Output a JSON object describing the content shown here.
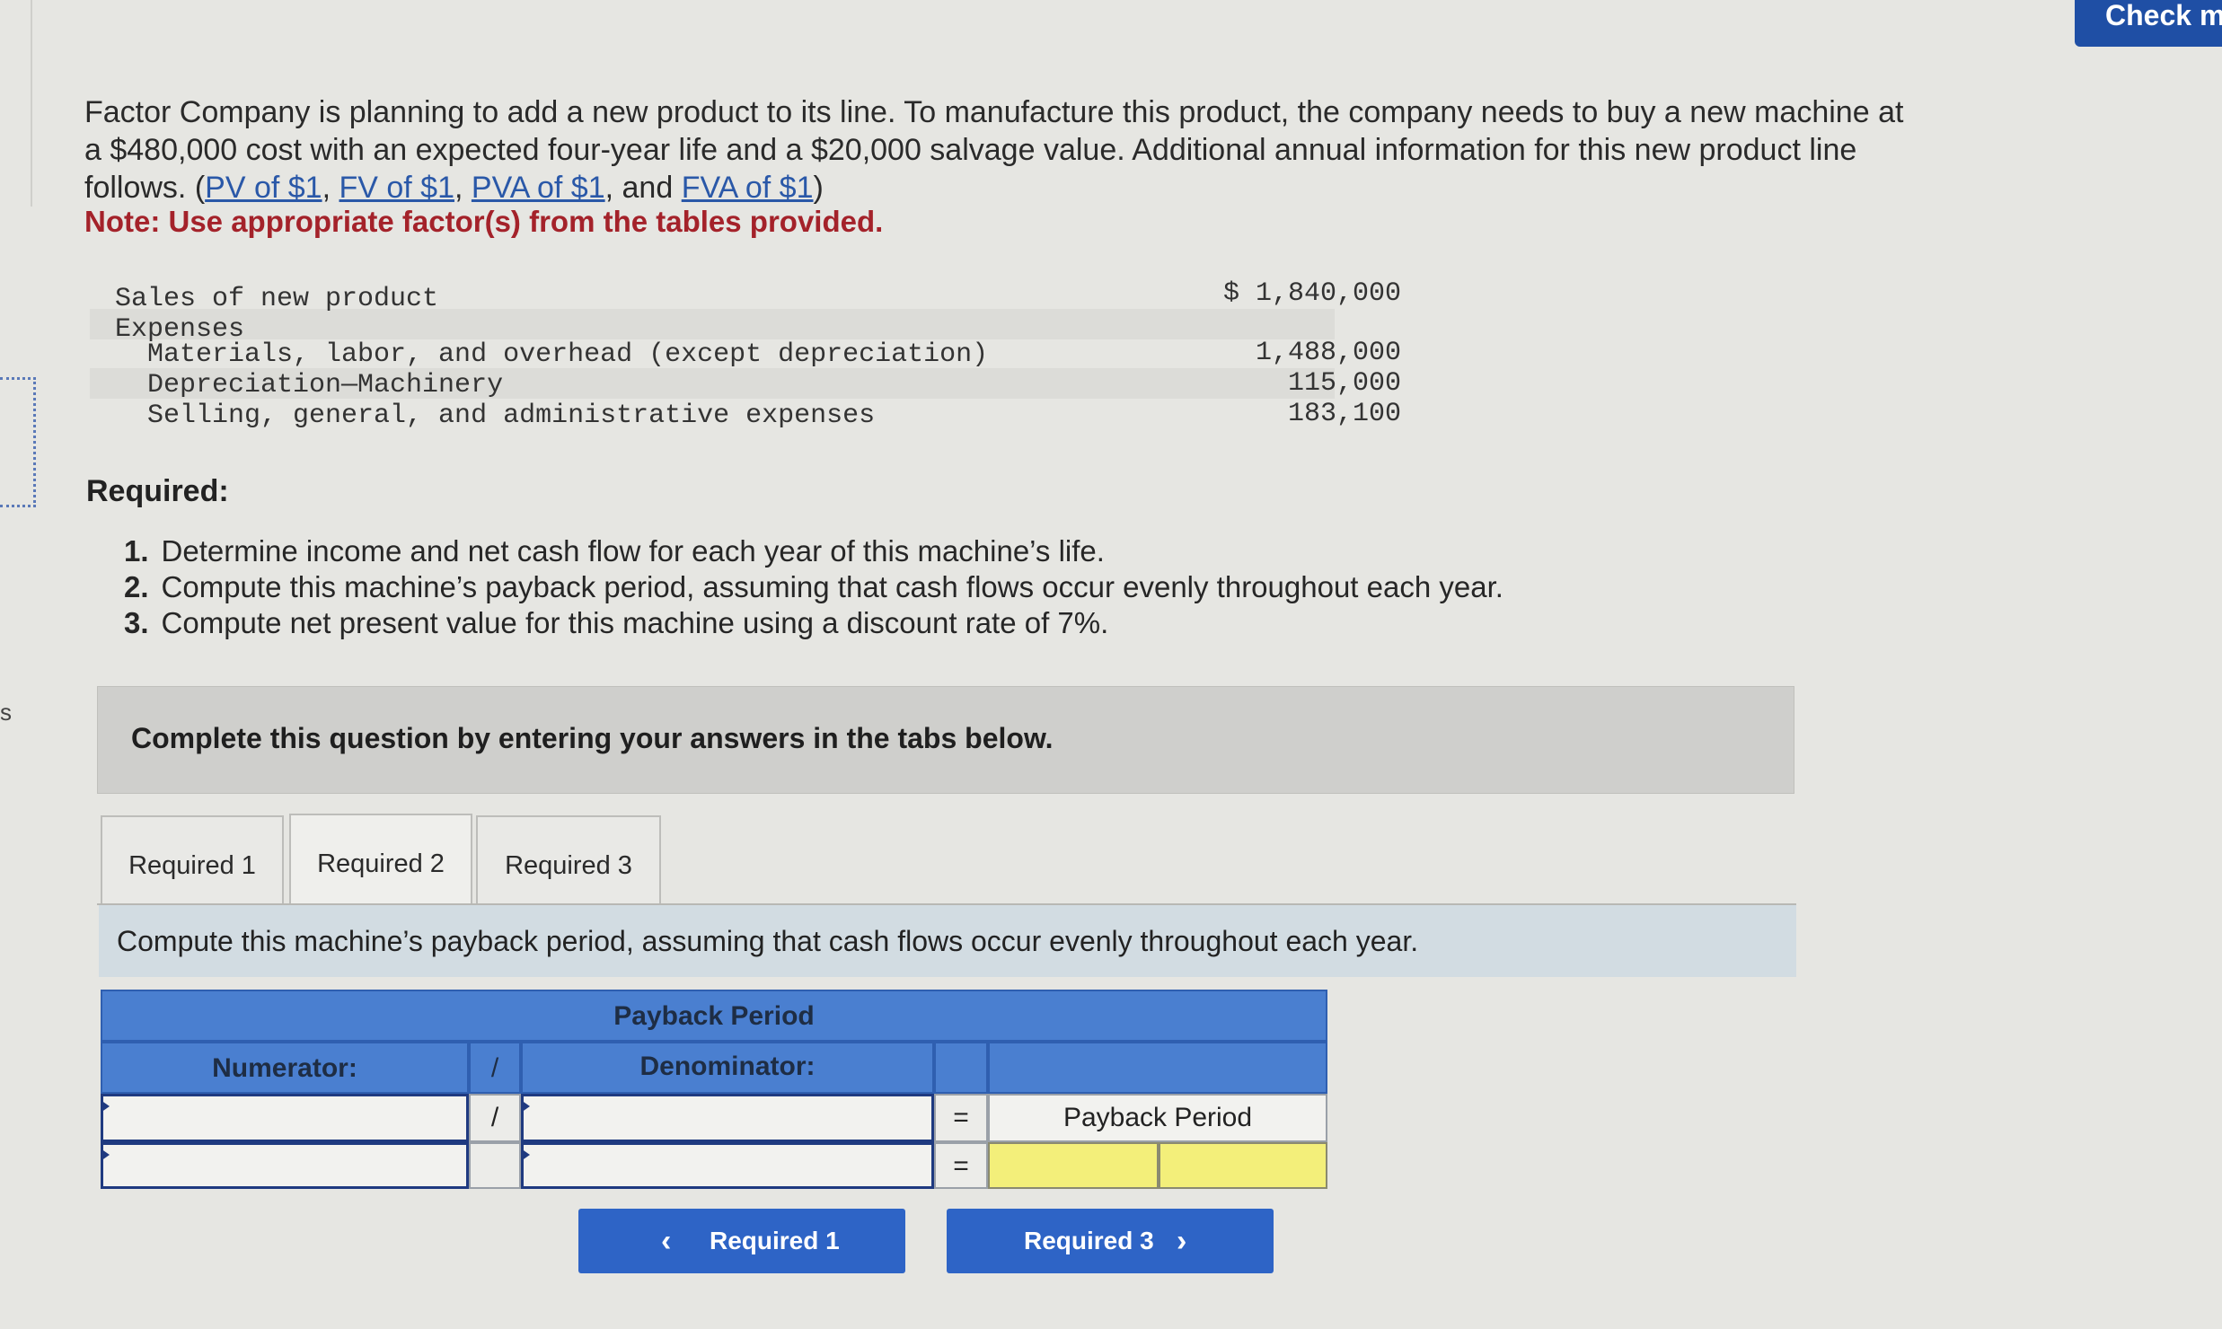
{
  "header": {
    "check_label": "Check my work"
  },
  "edge": {
    "letter": "s"
  },
  "problem": {
    "intro_lines": [
      "Factor Company is planning to add a new product to its line. To manufacture this product, the company needs to buy a new machine at",
      "a $480,000 cost with an expected four-year life and a $20,000 salvage value. Additional annual information for this new product line",
      "follows."
    ],
    "links": [
      "PV of $1",
      "FV of $1",
      "PVA of $1",
      "FVA of $1"
    ],
    "link_sep_and": "and",
    "note": "Note: Use appropriate factor(s) from the tables provided."
  },
  "income_table": {
    "rows": [
      {
        "label": "Sales of new product",
        "value": "$ 1,840,000"
      },
      {
        "label": "Expenses",
        "value": ""
      },
      {
        "label": "  Materials, labor, and overhead (except depreciation)",
        "value": "1,488,000"
      },
      {
        "label": "  Depreciation—Machinery",
        "value": "115,000"
      },
      {
        "label": "  Selling, general, and administrative expenses",
        "value": "183,100"
      }
    ]
  },
  "required": {
    "title": "Required:",
    "items": [
      {
        "n": "1.",
        "text": "Determine income and net cash flow for each year of this machine’s life."
      },
      {
        "n": "2.",
        "text": "Compute this machine’s payback period, assuming that cash flows occur evenly throughout each year."
      },
      {
        "n": "3.",
        "text": "Compute net present value for this machine using a discount rate of 7%."
      }
    ]
  },
  "instructions": "Complete this question by entering your answers in the tabs below.",
  "tabs": [
    {
      "label": "Required 1",
      "active": false
    },
    {
      "label": "Required 2",
      "active": true
    },
    {
      "label": "Required 3",
      "active": false
    }
  ],
  "prompt": "Compute this machine’s payback period, assuming that cash flows occur evenly throughout each year.",
  "payback_table": {
    "title": "Payback Period",
    "numerator_label": "Numerator:",
    "slash": "/",
    "denominator_label": "Denominator:",
    "equals": "=",
    "result_label": "Payback Period",
    "row1": {
      "numerator": "",
      "denominator": ""
    },
    "row2": {
      "numerator": "",
      "denominator": "",
      "result": ""
    }
  },
  "nav": {
    "prev_label": "Required 1",
    "next_label": "Required 3",
    "prev_icon": "chevron-left-icon",
    "next_icon": "chevron-right-icon"
  },
  "colors": {
    "accent": "#2e64c6",
    "note_red": "#a4222a",
    "header_blue": "#4a7fd0",
    "answer_yellow": "#f3ef7a"
  }
}
